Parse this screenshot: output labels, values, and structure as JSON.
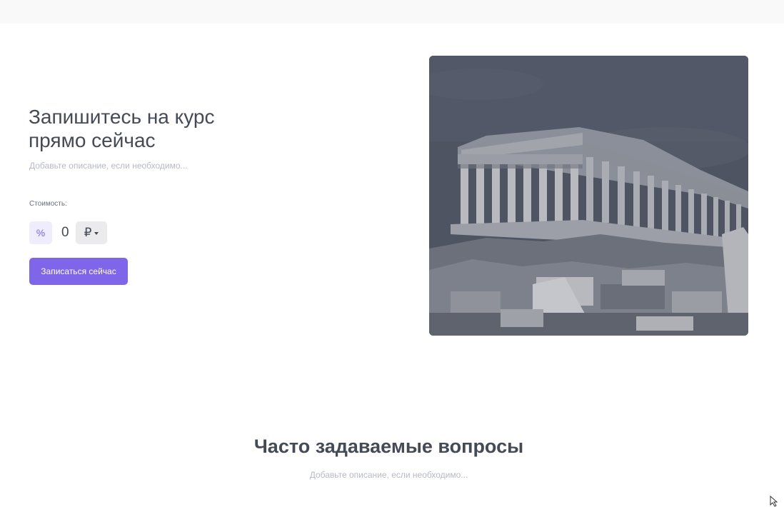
{
  "hero": {
    "title": "Запишитесь на курс прямо сейчас",
    "description": "Добавьте описание, если необходимо..."
  },
  "pricing": {
    "label": "Стоимость:",
    "discount_symbol": "%",
    "value": "0",
    "currency": "₽"
  },
  "cta": {
    "enroll_label": "Записаться сейчас"
  },
  "faq": {
    "title": "Часто задаваемые вопросы",
    "description": "Добавьте описание, если необходимо..."
  },
  "colors": {
    "accent": "#7f65e8",
    "accent_light": "#efedfb",
    "text": "#454a57",
    "muted": "#b7b9c4",
    "image_tint": "#505564"
  },
  "icons": {
    "currency_dropdown": "chevron-down-icon",
    "cursor": "mouse-pointer-icon"
  }
}
